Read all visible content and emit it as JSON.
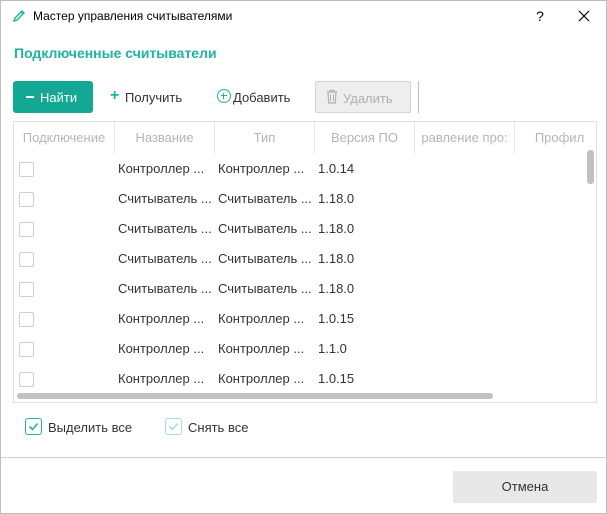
{
  "window": {
    "title": "Мастер управления считывателями",
    "help_label": "?",
    "icon": "pen-icon"
  },
  "section": {
    "title": "Подключенные считыватели"
  },
  "toolbar": {
    "find_label": "Найти",
    "get_label": "Получить",
    "add_label": "Добавить",
    "delete_label": "Удалить"
  },
  "grid": {
    "columns": [
      "Подключение",
      "Название",
      "Тип",
      "Версия ПО",
      "равление про:",
      "Профил"
    ],
    "rows": [
      {
        "name": "Контроллер ...",
        "type": "Контроллер ...",
        "version": "1.0.14"
      },
      {
        "name": "Считыватель ...",
        "type": "Считыватель ...",
        "version": "1.18.0"
      },
      {
        "name": "Считыватель ...",
        "type": "Считыватель ...",
        "version": "1.18.0"
      },
      {
        "name": "Считыватель ...",
        "type": "Считыватель ...",
        "version": "1.18.0"
      },
      {
        "name": "Считыватель ...",
        "type": "Считыватель ...",
        "version": "1.18.0"
      },
      {
        "name": "Контроллер ...",
        "type": "Контроллер ...",
        "version": "1.0.15"
      },
      {
        "name": "Контроллер ...",
        "type": "Контроллер ...",
        "version": "1.1.0"
      },
      {
        "name": "Контроллер ...",
        "type": "Контроллер ...",
        "version": "1.0.15"
      }
    ]
  },
  "selection": {
    "select_all_label": "Выделить все",
    "deselect_all_label": "Снять все"
  },
  "footer": {
    "cancel_label": "Отмена"
  },
  "colors": {
    "accent": "#13a893",
    "title": "#1fb3a0"
  }
}
